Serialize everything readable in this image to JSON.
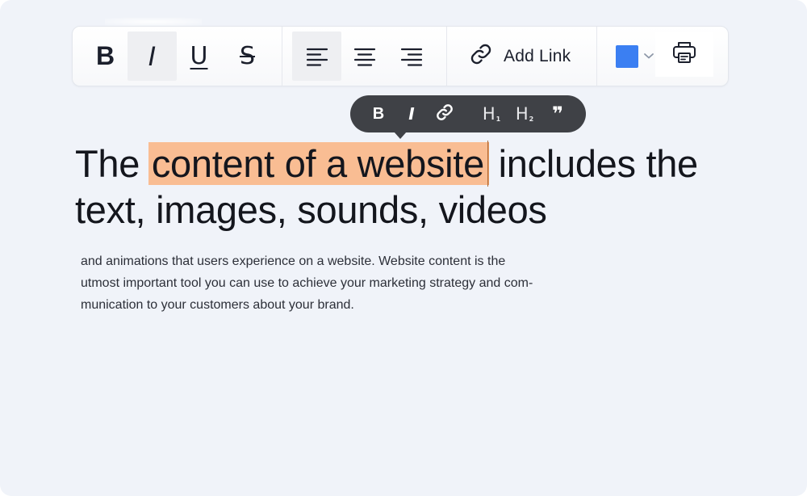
{
  "toolbar": {
    "add_link_label": "Add Link",
    "color_swatch": "#3b7ff2",
    "buttons": {
      "bold": "B",
      "italic": "I",
      "underline": "U",
      "strikethrough": "S"
    },
    "icons": {
      "align_left": "align-left-icon",
      "align_center": "align-center-icon",
      "align_right": "align-right-icon",
      "link": "link-icon",
      "color_dropdown": "chevron-down-icon",
      "print": "printer-icon"
    }
  },
  "bubble": {
    "bold": "B",
    "italic": "I",
    "h1": "H",
    "h1_sub": "1",
    "h2": "H",
    "h2_sub": "2",
    "quote": "❞",
    "icons": {
      "link": "link-icon"
    }
  },
  "document": {
    "headline_before": "The ",
    "headline_selected": "content of a website",
    "headline_after": " includes the text, images, sounds, videos",
    "body_lines": [
      "and animations that users experience on a website. Website content is the",
      "utmost important tool you can use to achieve your marketing strategy and com-",
      "munication to your customers about your brand."
    ]
  },
  "colors": {
    "highlight": "#f9bd93",
    "bubble_bg": "#3f4146",
    "canvas_bg": "#f0f3f9"
  }
}
